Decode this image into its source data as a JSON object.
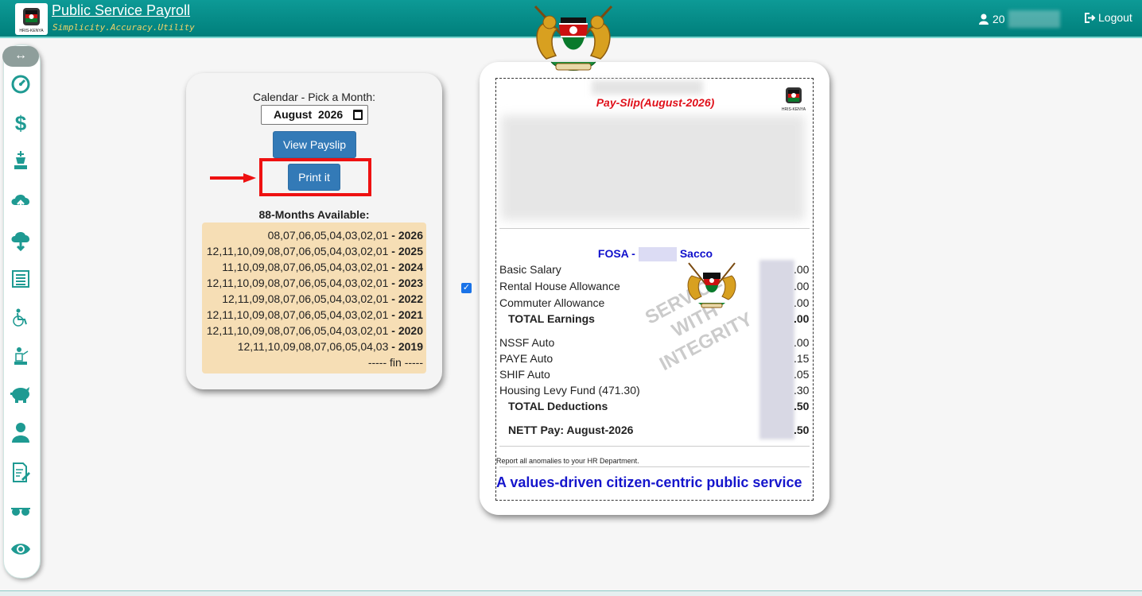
{
  "header": {
    "title": "Public Service Payroll",
    "tagline": "Simplicity.Accuracy.Utility",
    "logo_text": "HRIS-KENYA",
    "user_label": "20",
    "logout_label": "Logout"
  },
  "sidebar": {
    "toggle_icon": "↔",
    "items": [
      {
        "name": "dashboard-icon"
      },
      {
        "name": "dollar-icon"
      },
      {
        "name": "chess-king-icon"
      },
      {
        "name": "cloud-upload-icon"
      },
      {
        "name": "cloud-download-icon"
      },
      {
        "name": "list-icon"
      },
      {
        "name": "wheelchair-icon"
      },
      {
        "name": "user-machine-icon"
      },
      {
        "name": "piggy-bank-icon"
      },
      {
        "name": "user-icon"
      },
      {
        "name": "document-edit-icon"
      },
      {
        "name": "glasses-icon"
      },
      {
        "name": "eye-icon"
      }
    ]
  },
  "calendar": {
    "label": "Calendar - Pick a Month:",
    "value": "August  2026",
    "view_button": "View Payslip",
    "print_button": "Print it",
    "months_title": "88-Months Available:",
    "months": [
      {
        "list": "08,07,06,05,04,03,02,01",
        "year": "2026"
      },
      {
        "list": "12,11,10,09,08,07,06,05,04,03,02,01",
        "year": "2025"
      },
      {
        "list": "11,10,09,08,07,06,05,04,03,02,01",
        "year": "2024"
      },
      {
        "list": "12,11,10,09,08,07,06,05,04,03,02,01",
        "year": "2023"
      },
      {
        "list": "12,11,09,08,07,06,05,04,03,02,01",
        "year": "2022"
      },
      {
        "list": "12,11,10,09,08,07,06,05,04,03,02,01",
        "year": "2021"
      },
      {
        "list": "12,11,10,09,08,07,06,05,04,03,02,01",
        "year": "2020"
      },
      {
        "list": "12,11,10,09,08,07,06,05,04,03",
        "year": "2019"
      }
    ],
    "end_label": "----- fin -----"
  },
  "payslip": {
    "title": "Pay-Slip(August-2026)",
    "logo_text": "HRIS-KENYA",
    "sacco_prefix": "FOSA -",
    "sacco_suffix": "Sacco",
    "earnings": [
      {
        "label": "Basic Salary",
        "amount": ".00"
      },
      {
        "label": "Rental House Allowance",
        "amount": ".00"
      },
      {
        "label": "Commuter Allowance",
        "amount": ".00"
      }
    ],
    "total_earnings": {
      "label": "TOTAL Earnings",
      "amount": ".00"
    },
    "deductions": [
      {
        "label": "NSSF Auto",
        "amount": ".00"
      },
      {
        "label": "PAYE Auto",
        "amount": ".15"
      },
      {
        "label": "SHIF Auto",
        "amount": ".05"
      },
      {
        "label": "Housing Levy Fund (471.30)",
        "amount": ".30"
      }
    ],
    "total_deductions": {
      "label": "TOTAL Deductions",
      "amount": ".50"
    },
    "nett": {
      "label": "NETT Pay: August-2026",
      "amount": ".50"
    },
    "watermark": [
      "SERVICE",
      "WITH",
      "INTEGRITY"
    ],
    "report_note": "Report all anomalies to your HR Department.",
    "motto": "A values-driven citizen-centric public service"
  },
  "colors": {
    "header": "#00857f",
    "accent": "#1e9a92",
    "button": "#337ab7",
    "highlight": "#ee1111",
    "slip_title": "#e0101a",
    "motto": "#1515cc"
  }
}
